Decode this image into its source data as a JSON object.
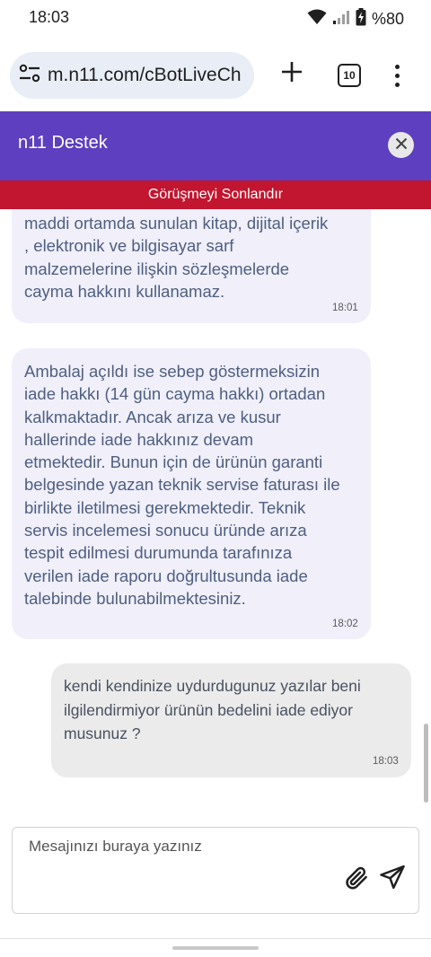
{
  "status_bar": {
    "time": "18:03",
    "battery": "%80",
    "icons": [
      "wifi-icon",
      "signal-icon",
      "battery-charging-icon"
    ]
  },
  "browser": {
    "url": "m.n11.com/cBotLiveCh",
    "tab_count": "10",
    "icons": [
      "site-settings-icon",
      "new-tab-plus-icon",
      "tab-switcher-icon",
      "more-vert-icon"
    ]
  },
  "chat": {
    "title": "n11 Destek",
    "end_chat_label": "Görüşmeyi Sonlandır",
    "messages": [
      {
        "sender": "bot",
        "text": "maddi ortamda sunulan kitap, dijital içerik\n, elektronik ve bilgisayar sarf\nmalzemelerine ilişkin sözleşmelerde\ncayma hakkını kullanamaz.",
        "time": "18:01"
      },
      {
        "sender": "bot",
        "text": "Ambalaj açıldı ise sebep göstermeksizin\niade hakkı (14 gün cayma hakkı) ortadan\nkalkmaktadır. Ancak arıza ve kusur\nhallerinde iade hakkınız devam\netmektedir. Bunun için de ürünün garanti\nbelgesinde yazan teknik servise faturası ile\nbirlikte iletilmesi gerekmektedir. Teknik\nservis incelemesi sonucu üründe arıza\ntespit edilmesi durumunda tarafınıza\nverilen iade raporu doğrultusunda iade\ntalebinde bulunabilmektesiniz.",
        "time": "18:02"
      },
      {
        "sender": "user",
        "text": "kendi kendinize uydurdugunuz yazılar beni\nilgilendirmiyor ürünün bedelini iade ediyor\nmusunuz ?",
        "time": "18:03"
      }
    ],
    "input_placeholder": "Mesajınızı buraya yazınız",
    "input_value": "",
    "composer_icons": [
      "paperclip-icon",
      "send-icon"
    ]
  },
  "colors": {
    "header": "#5d3fbf",
    "end_bar": "#c2152f",
    "bot_bubble": "#f0effa",
    "user_bubble": "#ebebeb",
    "bot_text": "#4f5f80"
  }
}
